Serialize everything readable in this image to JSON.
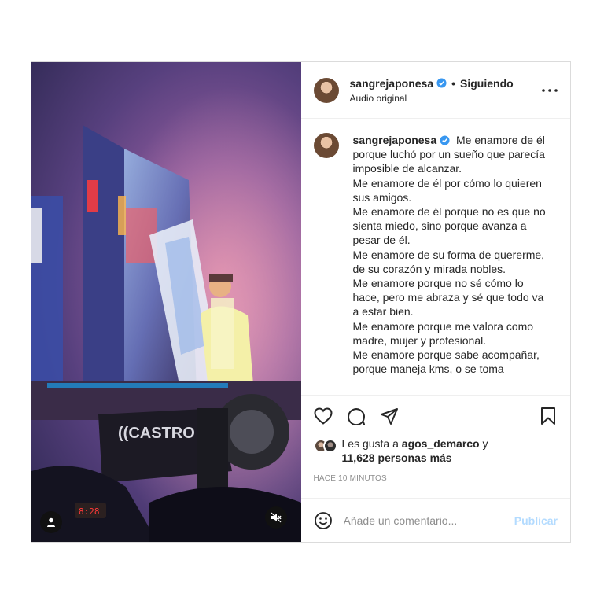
{
  "post": {
    "username": "sangrejaponesa",
    "separator": "•",
    "follow_state": "Siguiendo",
    "audio": "Audio original",
    "caption_paragraphs": [
      "Me enamore de él porque luchó por un sueño que parecía imposible de alcanzar.",
      "Me enamore de él por cómo lo quieren sus amigos.",
      "Me enamore de él porque no es que no sienta miedo, sino porque avanza a pesar de él.",
      "Me enamore de su forma de quererme, de su corazón y mirada nobles.",
      "Me enamore porque no sé cómo lo hace, pero me abraza y sé que todo va a estar bien.",
      "Me enamore porque me valora como madre, mujer y profesional.",
      "Me enamore porque sabe acompañar, porque maneja kms, o se toma"
    ],
    "likes_prefix": "Les gusta a",
    "likes_user": "agos_demarco",
    "likes_connector": "y",
    "likes_count": "11,628 personas más",
    "time": "HACE 10 MINUTOS",
    "comment_placeholder": "Añade un comentario...",
    "publish_label": "Publicar",
    "media_sign_text": "CASTRO"
  },
  "icons": {
    "verified": "verified-badge-icon",
    "more": "more-options-icon",
    "like": "heart-icon",
    "comment": "comment-icon",
    "share": "share-icon",
    "save": "bookmark-icon",
    "emoji": "emoji-icon",
    "user": "user-tag-icon",
    "mute": "muted-audio-icon"
  },
  "colors": {
    "verified": "#3897f0",
    "publish": "#b3dbff",
    "muted_text": "#8e8e8e"
  }
}
